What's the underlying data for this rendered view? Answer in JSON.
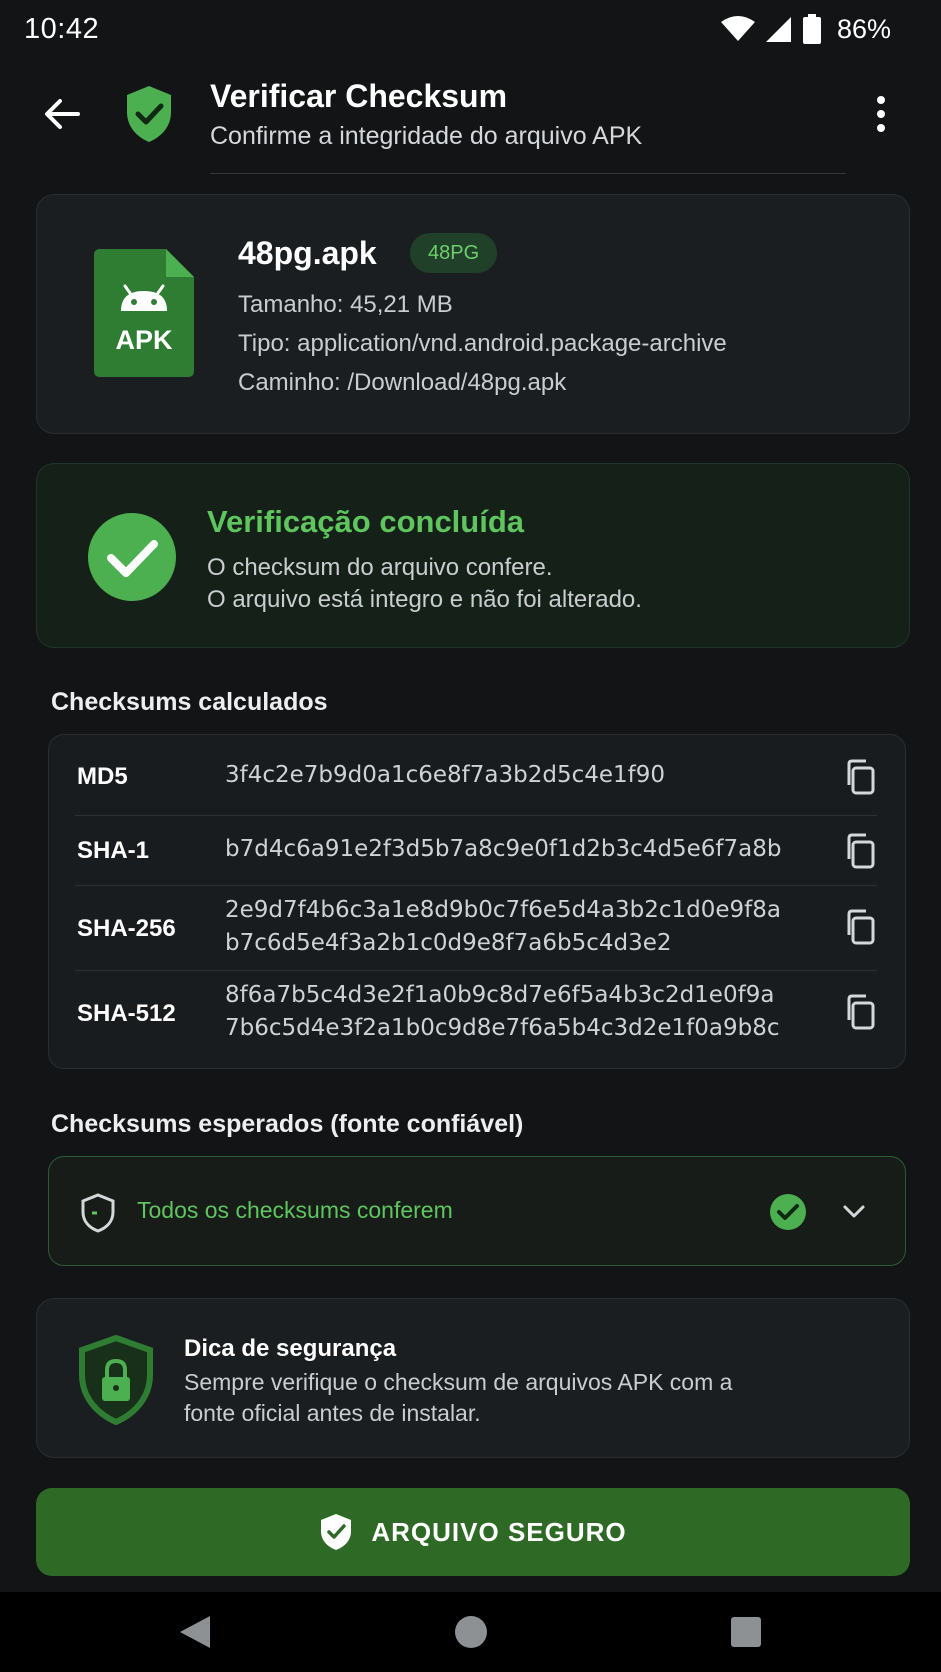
{
  "status_bar": {
    "time": "10:42",
    "battery": "86%"
  },
  "app_bar": {
    "title": "Verificar Checksum",
    "subtitle": "Confirme a integridade do arquivo APK"
  },
  "file": {
    "icon_label": "APK",
    "name": "48pg.apk",
    "badge": "48PG",
    "size": "Tamanho: 45,21 MB",
    "type": "Tipo: application/vnd.android.package-archive",
    "path": "Caminho: /Download/48pg.apk"
  },
  "verification": {
    "title": "Verificação concluída",
    "line1": "O checksum do arquivo confere.",
    "line2": "O arquivo está integro e não foi alterado."
  },
  "computed": {
    "title": "Checksums calculados",
    "rows": [
      {
        "algo": "MD5",
        "value": "3f4c2e7b9d0a1c6e8f7a3b2d5c4e1f90"
      },
      {
        "algo": "SHA-1",
        "value": "b7d4c6a91e2f3d5b7a8c9e0f1d2b3c4d5e6f7a8b"
      },
      {
        "algo": "SHA-256",
        "value": "2e9d7f4b6c3a1e8d9b0c7f6e5d4a3b2c1d0e9f8a\nb7c6d5e4f3a2b1c0d9e8f7a6b5c4d3e2"
      },
      {
        "algo": "SHA-512",
        "value": "8f6a7b5c4d3e2f1a0b9c8d7e6f5a4b3c2d1e0f9a\n7b6c5d4e3f2a1b0c9d8e7f6a5b4c3d2e1f0a9b8c"
      }
    ]
  },
  "expected": {
    "title": "Checksums esperados (fonte confiável)",
    "status": "Todos os checksums conferem"
  },
  "tip": {
    "title": "Dica de segurança",
    "line1": "Sempre verifique o checksum de arquivos APK com a",
    "line2": "fonte oficial antes de instalar."
  },
  "action": {
    "label": "ARQUIVO SEGURO"
  },
  "colors": {
    "accent_green": "#5fc55f",
    "button_green": "#2e6a26",
    "background": "#121416",
    "card": "#1b1e20"
  }
}
